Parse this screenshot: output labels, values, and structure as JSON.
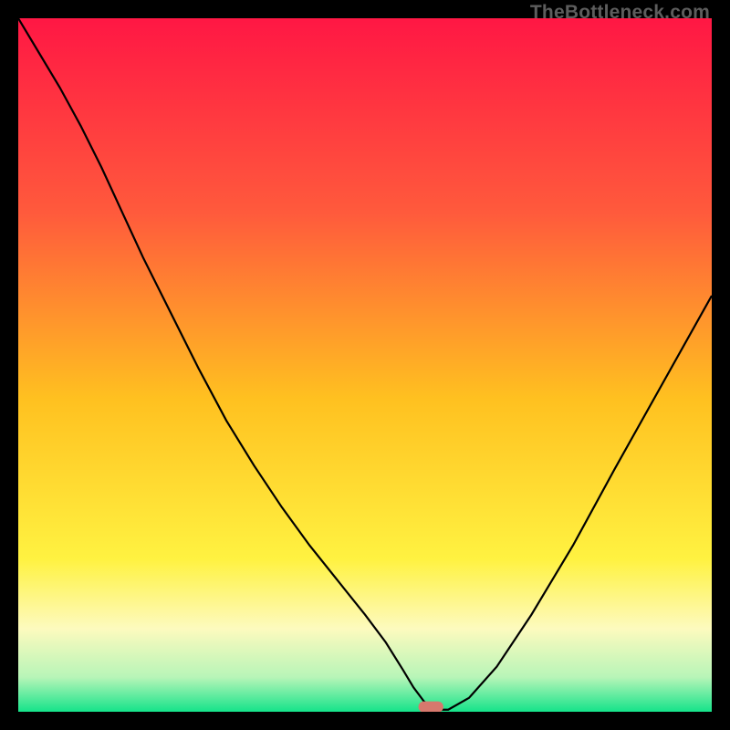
{
  "watermark": "TheBottleneck.com",
  "chart_data": {
    "type": "line",
    "title": "",
    "xlabel": "",
    "ylabel": "",
    "xlim": [
      0,
      100
    ],
    "ylim": [
      0,
      100
    ],
    "legend": false,
    "grid": false,
    "background_gradient": [
      {
        "stop": 0.0,
        "color": "#ff1744"
      },
      {
        "stop": 0.28,
        "color": "#ff5a3c"
      },
      {
        "stop": 0.55,
        "color": "#ffc120"
      },
      {
        "stop": 0.78,
        "color": "#fff241"
      },
      {
        "stop": 0.88,
        "color": "#fdfabe"
      },
      {
        "stop": 0.95,
        "color": "#b8f5b8"
      },
      {
        "stop": 1.0,
        "color": "#15e38a"
      }
    ],
    "series": [
      {
        "name": "bottleneck-curve",
        "color": "#000000",
        "x": [
          0,
          3,
          6,
          9,
          12,
          15,
          18,
          22,
          26,
          30,
          34,
          38,
          42,
          46,
          50,
          53,
          55.5,
          57,
          58.5,
          60,
          62,
          65,
          69,
          74,
          80,
          86,
          93,
          100
        ],
        "y": [
          100,
          95,
          90,
          84.5,
          78.5,
          72,
          65.5,
          57.5,
          49.5,
          42,
          35.5,
          29.5,
          24,
          19,
          14,
          10,
          6,
          3.5,
          1.5,
          0.3,
          0.3,
          2,
          6.5,
          14,
          24,
          35,
          47.5,
          60
        ]
      }
    ],
    "marker": {
      "name": "optimal-pill",
      "cx": 59.5,
      "cy": 0.7,
      "width": 3.6,
      "height": 1.6,
      "color": "#d7786d"
    }
  }
}
